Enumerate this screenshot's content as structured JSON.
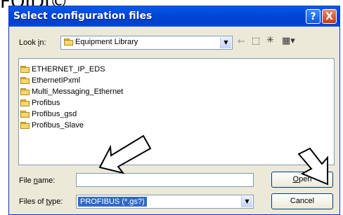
{
  "header_text": "FOIDI©",
  "window": {
    "title": "Select configuration files"
  },
  "look_in": {
    "label_pre": "Look ",
    "label_key": "i",
    "label_post": "n:",
    "value": "Equipment Library"
  },
  "folders": [
    "ETHERNET_IP_EDS",
    "EthernetIPxml",
    "Multi_Messaging_Ethernet",
    "Profibus",
    "Profibus_gsd",
    "Profibus_Slave"
  ],
  "file_name": {
    "label_pre": "File ",
    "label_key": "n",
    "label_post": "ame:",
    "value": ""
  },
  "file_type": {
    "label_pre": "Files of ",
    "label_key": "t",
    "label_post": "ype:",
    "value": "PROFIBUS (*.gs?)"
  },
  "buttons": {
    "open_key": "O",
    "open_rest": "pen",
    "cancel": "Cancel"
  },
  "icons": {
    "help": "?",
    "close": "X",
    "dropdown": "▼"
  }
}
